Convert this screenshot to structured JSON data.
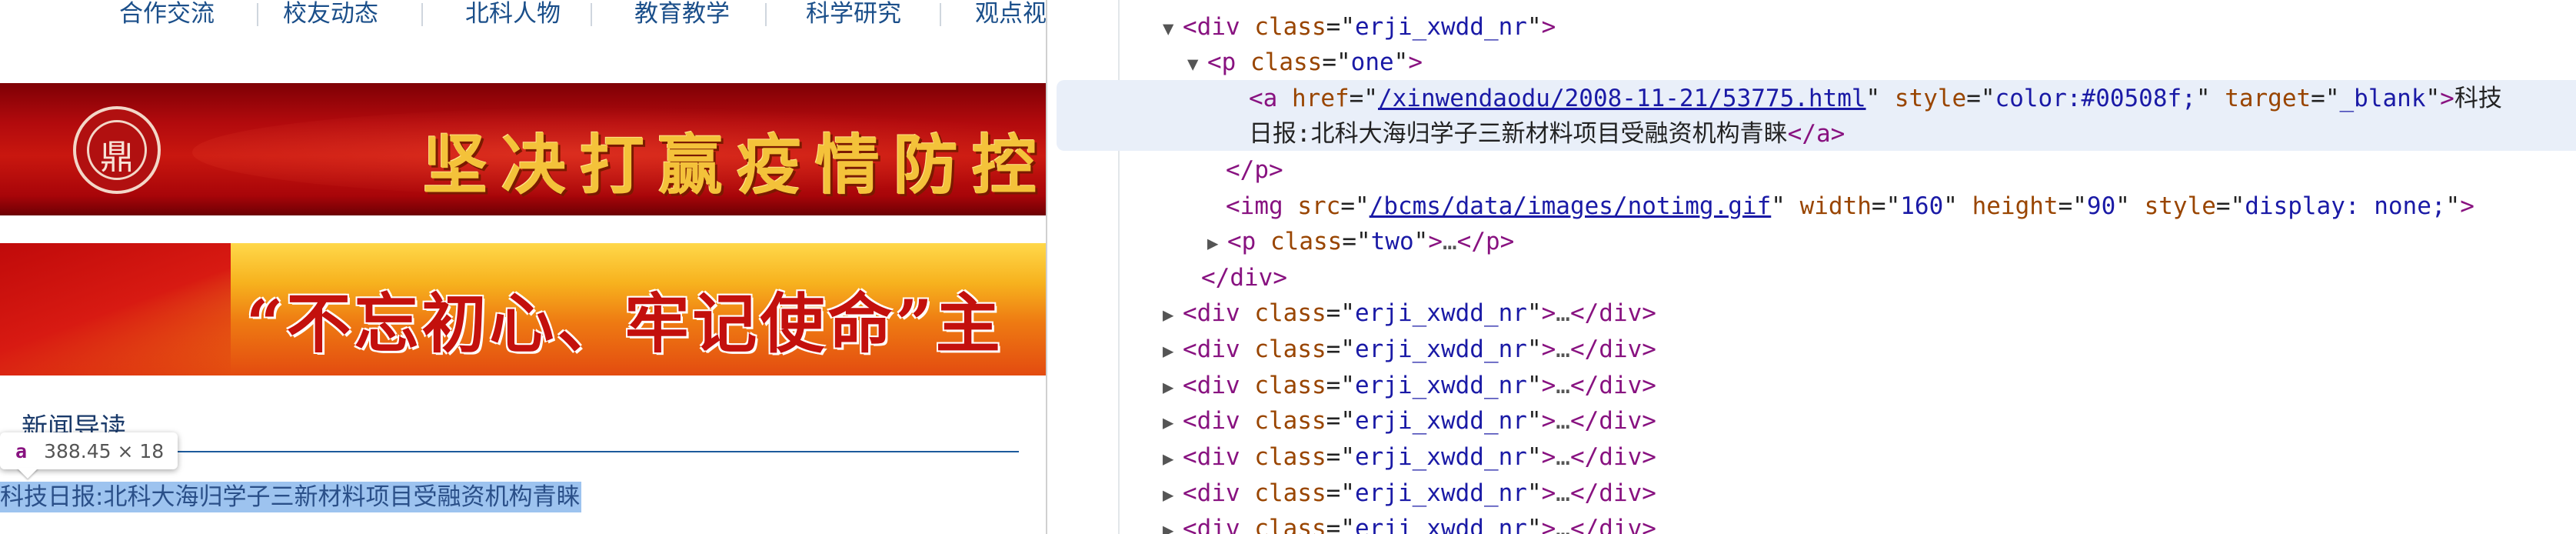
{
  "nav": {
    "items": [
      "合作交流",
      "校友动态",
      "北科人物",
      "教育教学",
      "科学研究",
      "观点视"
    ]
  },
  "banners": {
    "fight_epidemic": "坚决打赢疫情防控阻",
    "mission": "“不忘初心、牢记使命”主"
  },
  "section": {
    "title": "新闻导读"
  },
  "tooltip": {
    "tag": "a",
    "dimensions": "388.45 × 18"
  },
  "news_link": {
    "text": "科技日报:北科大海归学子三新材料项目受融资机构青睐"
  },
  "devtools": {
    "lines": {
      "div_open": {
        "tag": "div",
        "attr": "class",
        "value": "erji_xwdd_nr"
      },
      "p_open": {
        "tag": "p",
        "attr": "class",
        "value": "one"
      },
      "a_href": "/xinwendaodu/2008-11-21/53775.html",
      "a_style": "color:#00508f;",
      "a_target": "_blank",
      "a_text_head": "科技",
      "a_text_tail": "日报:北科大海归学子三新材料项目受融资机构青睐",
      "p_close": "p",
      "img_src": "/bcms/data/images/notimg.gif",
      "img_width": "160",
      "img_height": "90",
      "img_style": "display: none;",
      "p_two_value": "two",
      "collapsed_ellipsis": "…",
      "div_close": "div",
      "collapsed_div_value": "erji_xwdd_nr",
      "collapsed_div_partial": "erji_xwdd_nr"
    }
  },
  "colors": {
    "tag": "#881280",
    "attr_name": "#994500",
    "attr_value": "#1a1aa6",
    "selection": "#9dc3ef",
    "nav_text": "#1b4f8a"
  },
  "icons": {
    "expanded": "triangle-down-icon",
    "collapsed": "triangle-right-icon"
  }
}
